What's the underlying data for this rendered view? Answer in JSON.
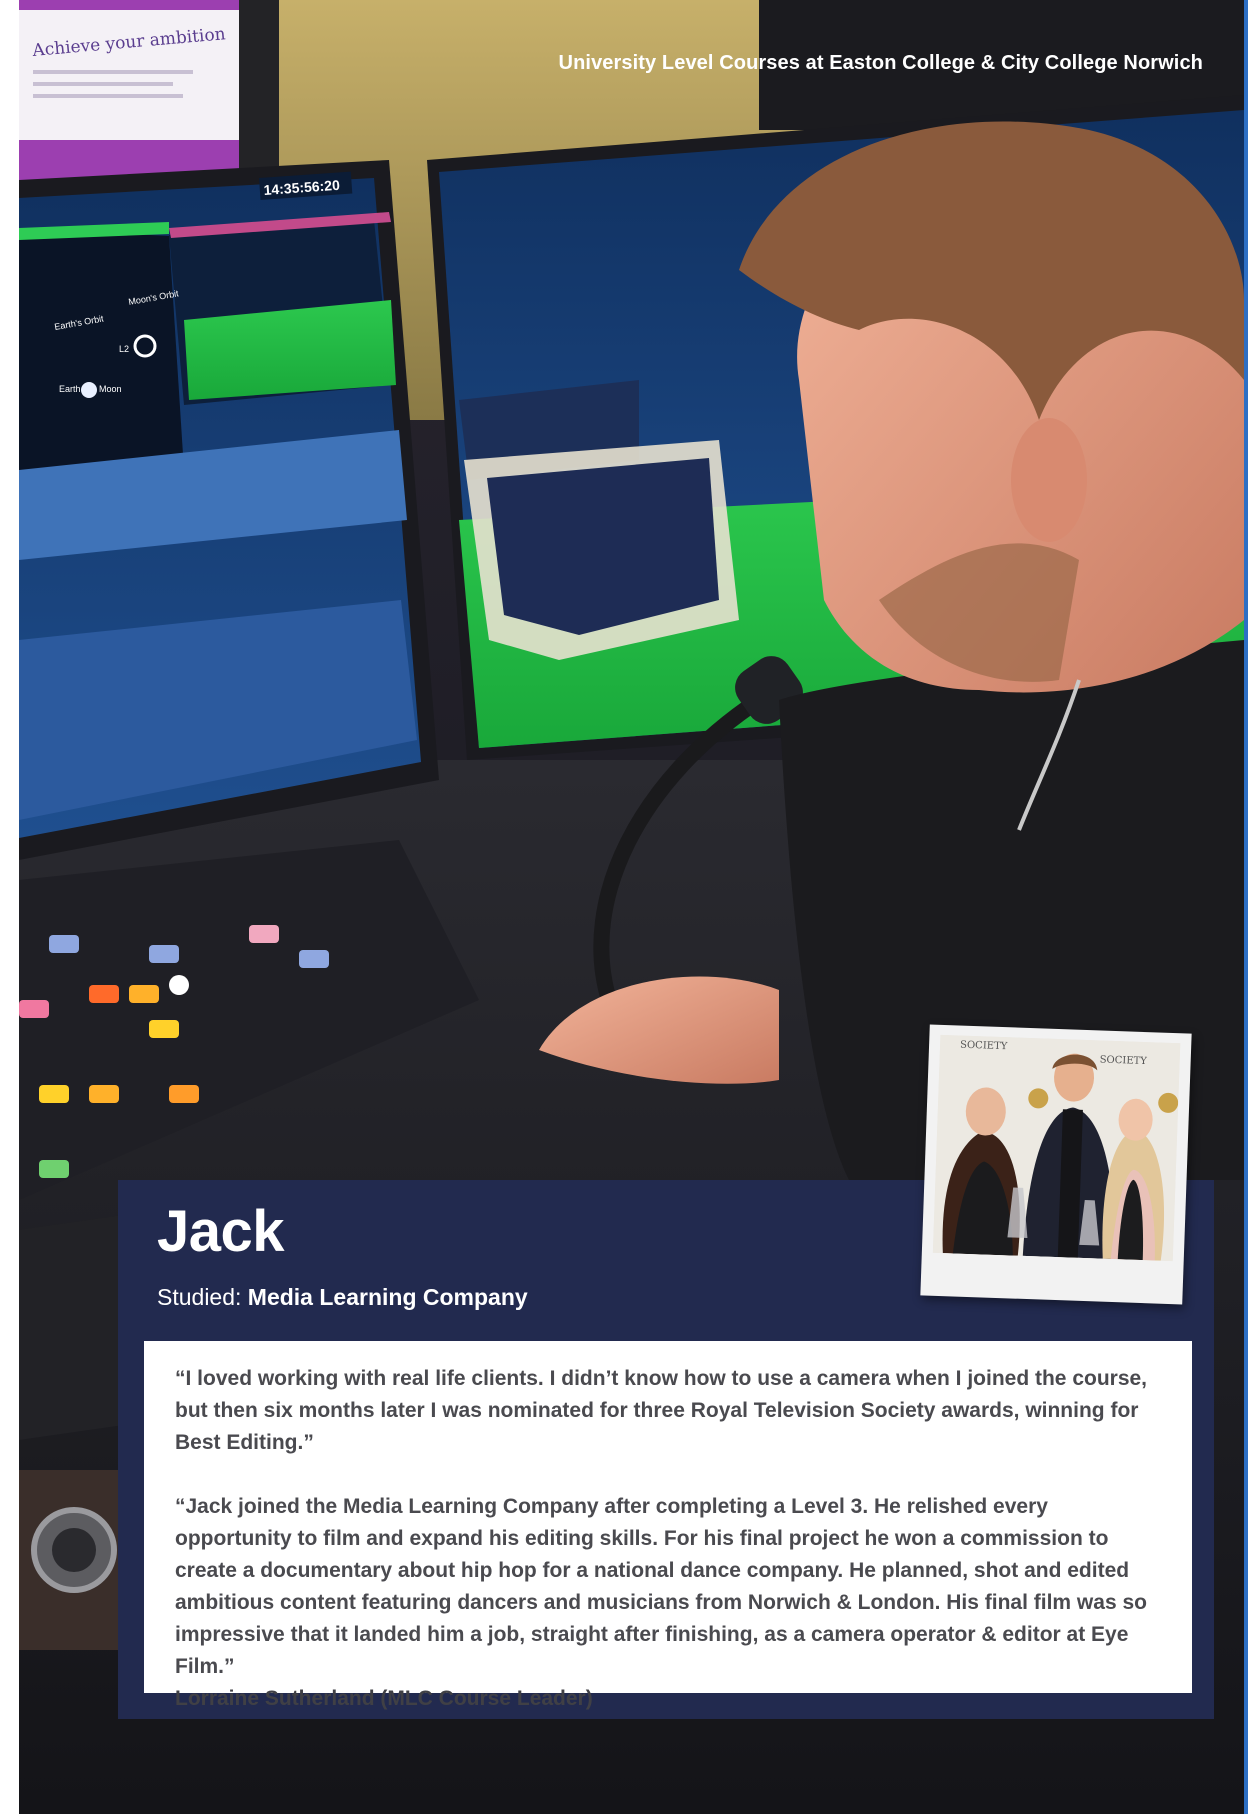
{
  "header": {
    "title": "University Level Courses at Easton College & City College Norwich"
  },
  "profile": {
    "name": "Jack",
    "studied_label": "Studied:",
    "course": "Media Learning Company"
  },
  "quotes": {
    "student_quote": "“I loved working with real life clients. I didn’t know how to use a camera when I joined the course, but then six months later I was nominated for three Royal Television Society awards, winning for Best Editing.”",
    "leader_quote": "“Jack joined the Media Learning Company after completing a Level 3. He relished every opportunity to film and expand his editing skills. For his final project he won a commission to create a documentary about hip hop for a national dance company. He planned, shot and edited ambitious content featuring dancers and musicians from Norwich & London. His final film was so impressive that it landed him a job, straight after finishing, as a camera operator & editor at Eye Film.”",
    "leader_attribution": "Lorraine Sutherland (MLC Course Leader)"
  },
  "background_photo": {
    "poster_text": "Achieve your ambition",
    "monitor_clock": "14:35:56:20",
    "orbit_labels": [
      "Earth's Orbit",
      "Moon's Orbit",
      "Earth",
      "Moon",
      "L2"
    ]
  },
  "polaroid": {
    "backdrop_words": [
      "SOCIETY",
      "SOCIETY"
    ]
  },
  "colors": {
    "card_navy": "#222a4f",
    "accent_blue": "#2d6fc4",
    "quote_text": "#4a4a4f"
  }
}
